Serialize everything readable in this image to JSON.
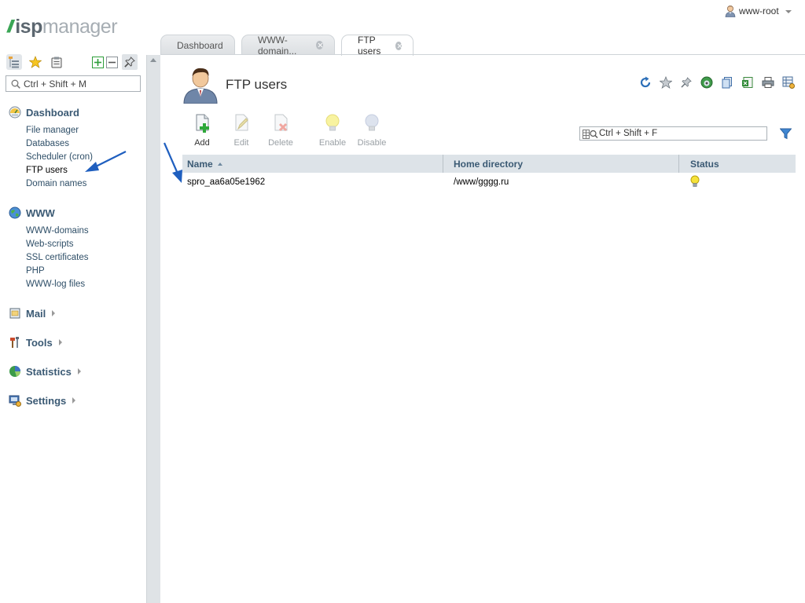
{
  "brand": {
    "logo_text_bold": "isp",
    "logo_text_light": "manager"
  },
  "user": {
    "name": "www-root"
  },
  "tabs": [
    {
      "label": "Dashboard",
      "closable": false,
      "active": false
    },
    {
      "label": "WWW-domain...",
      "closable": true,
      "active": false
    },
    {
      "label": "FTP users",
      "closable": true,
      "active": true
    }
  ],
  "sidebar": {
    "search_placeholder": "Ctrl + Shift + M",
    "groups": [
      {
        "label": "Dashboard",
        "icon": "dashboard-icon",
        "expanded": true,
        "items": [
          {
            "label": "File manager"
          },
          {
            "label": "Databases"
          },
          {
            "label": "Scheduler (cron)"
          },
          {
            "label": "FTP users",
            "active": true
          },
          {
            "label": "Domain names"
          }
        ]
      },
      {
        "label": "WWW",
        "icon": "globe-icon",
        "expanded": true,
        "items": [
          {
            "label": "WWW-domains"
          },
          {
            "label": "Web-scripts"
          },
          {
            "label": "SSL certificates"
          },
          {
            "label": "PHP"
          },
          {
            "label": "WWW-log files"
          }
        ]
      },
      {
        "label": "Mail",
        "icon": "mail-icon",
        "expanded": false
      },
      {
        "label": "Tools",
        "icon": "tools-icon",
        "expanded": false
      },
      {
        "label": "Statistics",
        "icon": "statistics-icon",
        "expanded": false
      },
      {
        "label": "Settings",
        "icon": "settings-icon",
        "expanded": false
      }
    ]
  },
  "page": {
    "title": "FTP users"
  },
  "toolbar": {
    "add": "Add",
    "edit": "Edit",
    "delete": "Delete",
    "enable": "Enable",
    "disable": "Disable"
  },
  "grid_search": {
    "placeholder": "Ctrl + Shift + F"
  },
  "table": {
    "columns": [
      "Name",
      "Home directory",
      "Status"
    ],
    "rows": [
      {
        "name": "spro_aa6a05e1962",
        "home": "/www/gggg.ru",
        "status": "enabled"
      }
    ]
  },
  "colors": {
    "accent": "#3b5a74",
    "brand_green": "#3aa655",
    "annotation_arrow": "#1f5fbf"
  }
}
